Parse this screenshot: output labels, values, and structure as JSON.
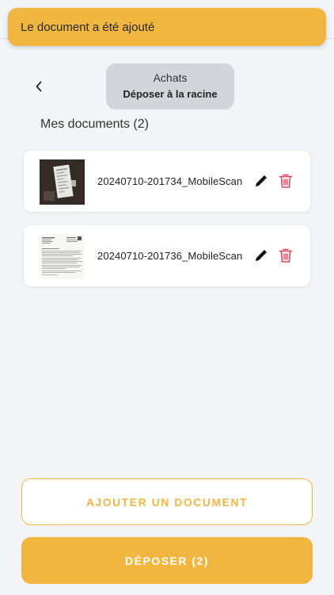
{
  "toast": {
    "message": "Le document a été ajouté"
  },
  "header": {
    "folder_name": "Achats",
    "folder_action": "Déposer à la racine"
  },
  "section": {
    "title": "Mes documents (2)"
  },
  "documents": [
    {
      "name": "20240710-201734_MobileScan",
      "thumb": "receipt-photo"
    },
    {
      "name": "20240710-201736_MobileScan",
      "thumb": "letter-scan"
    }
  ],
  "actions": {
    "add_label": "AJOUTER UN DOCUMENT",
    "submit_label": "DÉPOSER (2)"
  },
  "colors": {
    "accent": "#f1b63f",
    "background": "#f3f4f8",
    "delete": "#e0445a"
  }
}
